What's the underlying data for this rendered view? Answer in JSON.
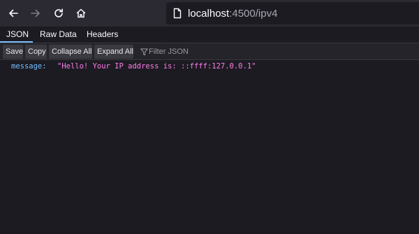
{
  "browser": {
    "back_icon": "arrow-left-icon",
    "forward_icon": "arrow-right-icon",
    "reload_icon": "reload-icon",
    "home_icon": "home-icon",
    "url_host": "localhost",
    "url_path": ":4500/ipv4"
  },
  "tabs": [
    {
      "label": "JSON",
      "active": true
    },
    {
      "label": "Raw Data",
      "active": false
    },
    {
      "label": "Headers",
      "active": false
    }
  ],
  "subtoolbar": {
    "save_label": "Save",
    "copy_label": "Copy",
    "collapse_label": "Collapse All",
    "expand_label": "Expand All",
    "filter_placeholder": "Filter JSON"
  },
  "json": {
    "rows": [
      {
        "key": "message:",
        "value": "\"Hello! Your IP address is: ::ffff:127.0.0.1\""
      }
    ]
  },
  "colors": {
    "background": "#1c1b22",
    "toolbar": "#2b2a33",
    "accent": "#75bfff",
    "string": "#ff7de9"
  }
}
